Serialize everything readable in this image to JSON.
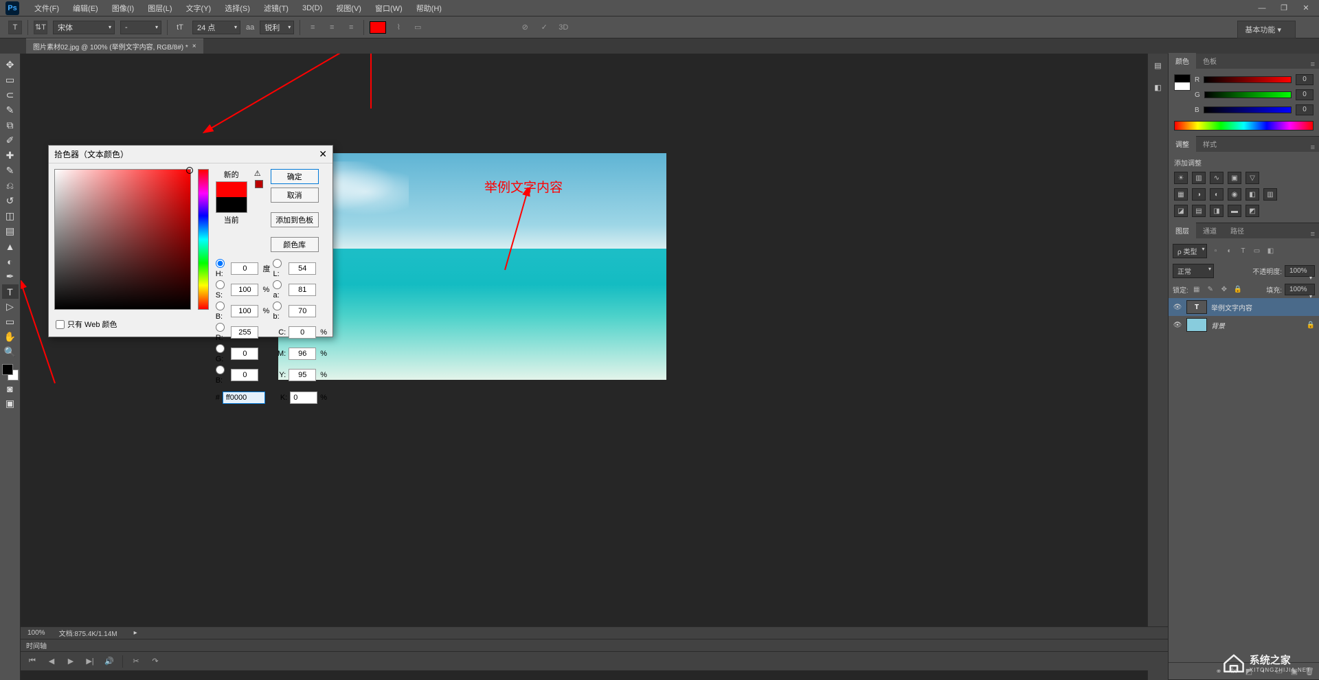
{
  "menubar": {
    "items": [
      "文件(F)",
      "编辑(E)",
      "图像(I)",
      "图层(L)",
      "文字(Y)",
      "选择(S)",
      "滤镜(T)",
      "3D(D)",
      "视图(V)",
      "窗口(W)",
      "帮助(H)"
    ]
  },
  "optionsbar": {
    "font_family": "宋体",
    "font_style": "-",
    "font_size": "24 点",
    "aa_label": "aa",
    "antialiasing": "锐利",
    "text_3d": "3D",
    "workspace": "基本功能"
  },
  "doctab": {
    "title": "图片素材02.jpg @ 100% (举例文字内容, RGB/8#) *"
  },
  "canvas": {
    "sample_text": "举例文字内容"
  },
  "picker": {
    "title": "拾色器（文本颜色）",
    "new_label": "新的",
    "current_label": "当前",
    "ok": "确定",
    "cancel": "取消",
    "add_to_swatches": "添加到色板",
    "color_libraries": "颜色库",
    "web_only_label": "只有 Web 颜色",
    "deg_suffix": "度",
    "pct_suffix": "%",
    "H": "0",
    "S": "100",
    "Bv": "100",
    "R": "255",
    "G": "0",
    "Bb": "0",
    "L": "54",
    "a": "81",
    "b": "70",
    "C": "0",
    "M": "96",
    "Y": "95",
    "K": "0",
    "hex_prefix": "#",
    "hex": "ff0000"
  },
  "status": {
    "zoom": "100%",
    "docinfo": "文档:875.4K/1.14M",
    "timeline_label": "时间轴"
  },
  "panels": {
    "color_tab": "颜色",
    "swatches_tab": "色板",
    "rgb": {
      "R": "0",
      "G": "0",
      "B": "0"
    },
    "adjust_tab": "调整",
    "styles_tab": "样式",
    "add_adjustment": "添加调整",
    "layers_tab": "图层",
    "channels_tab": "通道",
    "paths_tab": "路径",
    "filter_label": "ρ 类型",
    "blend_mode": "正常",
    "opacity_label": "不透明度:",
    "opacity_value": "100%",
    "lock_label": "锁定:",
    "fill_label": "填充:",
    "fill_value": "100%",
    "layer_text_name": "举例文字内容",
    "layer_bg_name": "背景"
  },
  "watermark": {
    "title": "系统之家",
    "sub": "XITONGZHIJIA.NET"
  }
}
